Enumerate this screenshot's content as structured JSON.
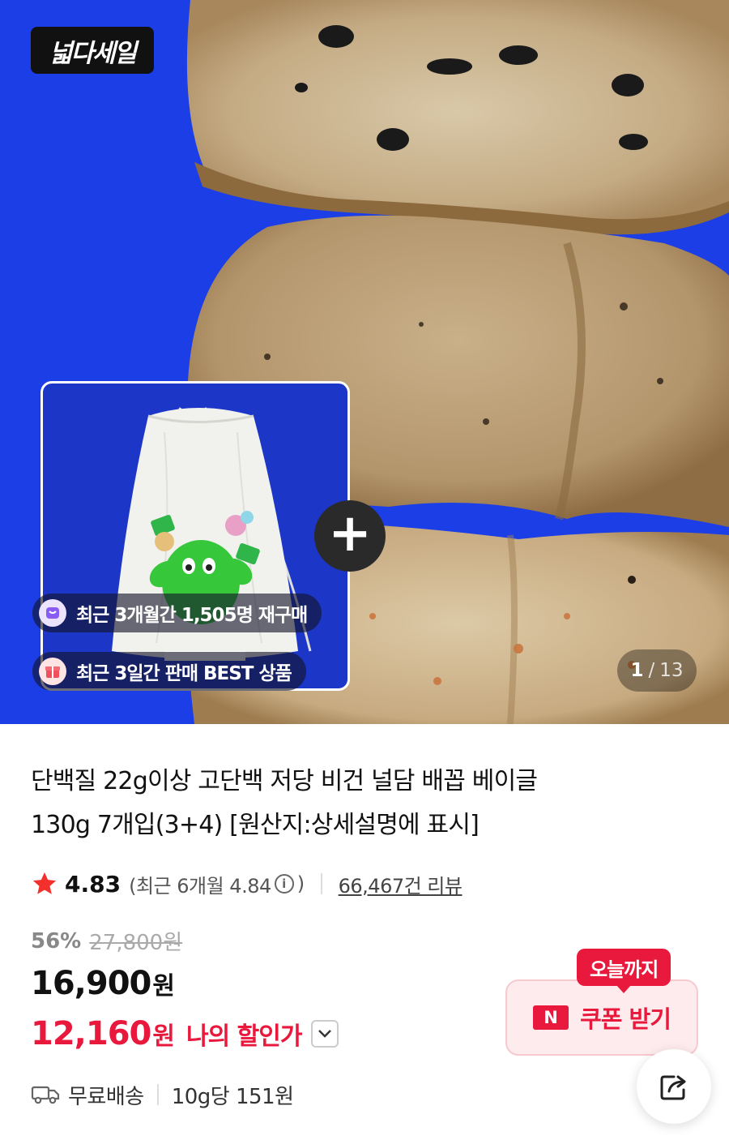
{
  "hero": {
    "sale_badge": "넓다세일",
    "gift_card": {
      "pills": [
        {
          "icon": "bag-icon",
          "text": "최근 3개월간 1,505명 재구매"
        },
        {
          "icon": "gift-icon",
          "text": "최근 3일간 판매 BEST 상품"
        }
      ]
    },
    "counter": {
      "current": "1",
      "separator": "/",
      "total": "13"
    }
  },
  "product": {
    "title_line1": "단백질 22g이상 고단백 저당 비건 널담 배꼽 베이글",
    "title_line2": "130g 7개입(3+4) [원산지:상세설명에 표시]",
    "rating": "4.83",
    "recent_open": "(최근 6개월 4.84",
    "recent_close": ")",
    "info_glyph": "i",
    "review_count": "66,467건 리뷰",
    "discount_rate": "56%",
    "original_price": "27,800원",
    "price": "16,900",
    "price_unit": "원",
    "my_price": "12,160",
    "my_price_unit": "원",
    "my_price_label": "나의 할인가"
  },
  "coupon": {
    "tag": "오늘까지",
    "logo": "N",
    "label": "쿠폰 받기"
  },
  "shipping": {
    "label": "무료배송",
    "unit_price": "10g당 151원"
  },
  "colors": {
    "accent_red": "#e8193c",
    "hero_blue": "#1b3ee6",
    "coupon_bg": "#fdebed"
  }
}
